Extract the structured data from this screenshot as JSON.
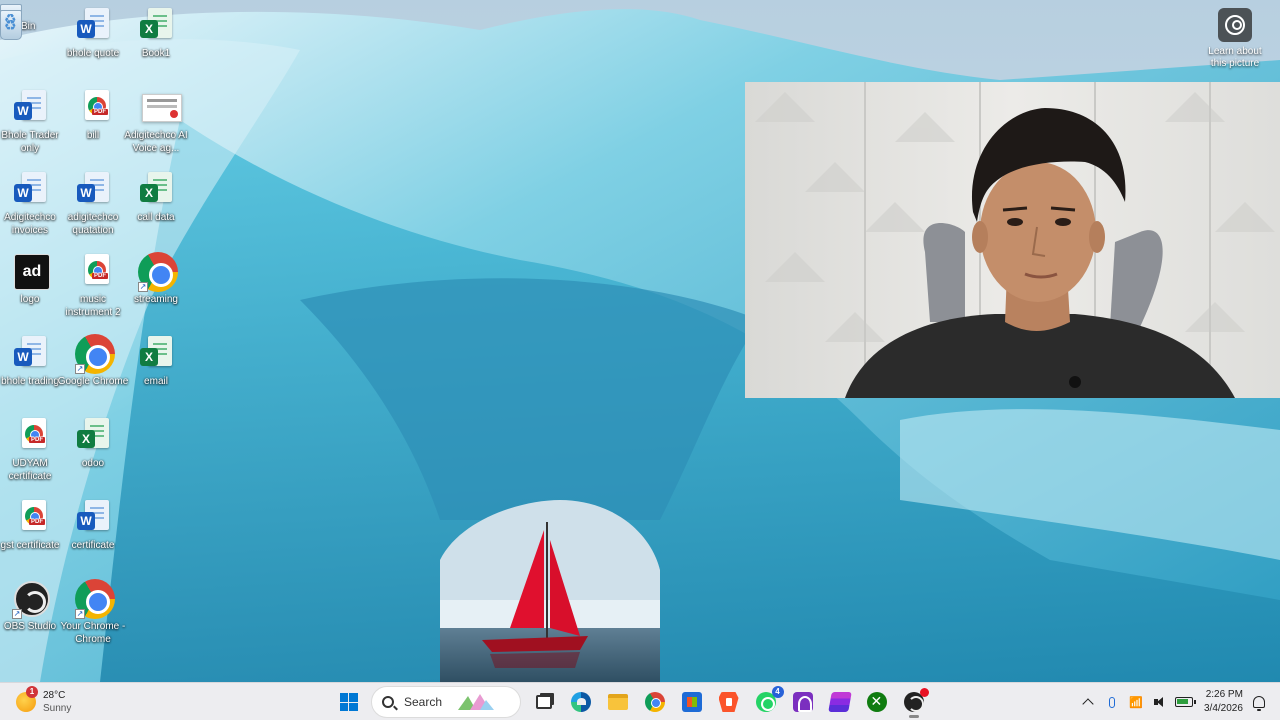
{
  "desktop": {
    "icons": [
      {
        "label": "Recycle Bin",
        "icon": "recycle-bin-icon",
        "type": "recycle"
      },
      {
        "label": "bhole quote",
        "icon": "word-document-icon",
        "type": "word"
      },
      {
        "label": "Book1",
        "icon": "excel-workbook-icon",
        "type": "excel"
      },
      {
        "label": "Bhole Trader only",
        "icon": "word-document-icon",
        "type": "word"
      },
      {
        "label": "bill",
        "icon": "pdf-document-icon",
        "type": "pdf"
      },
      {
        "label": "Adigitechco AI Voice ag...",
        "icon": "image-file-icon",
        "type": "image"
      },
      {
        "label": "Adigitechco invoices",
        "icon": "word-document-icon",
        "type": "word"
      },
      {
        "label": "adigitechco quatation",
        "icon": "word-document-icon",
        "type": "word"
      },
      {
        "label": "call data",
        "icon": "excel-workbook-icon",
        "type": "excel"
      },
      {
        "label": "logo",
        "icon": "logo-image-icon",
        "type": "logo"
      },
      {
        "label": "music instrument 2",
        "icon": "pdf-document-icon",
        "type": "pdf"
      },
      {
        "label": "streaming",
        "icon": "chrome-shortcut-icon",
        "type": "chrome"
      },
      {
        "label": "bhole trading",
        "icon": "word-document-icon",
        "type": "word"
      },
      {
        "label": "Google Chrome",
        "icon": "google-chrome-icon",
        "type": "chrome"
      },
      {
        "label": "email",
        "icon": "excel-workbook-icon",
        "type": "excel"
      },
      {
        "label": "UDYAM certificate",
        "icon": "pdf-document-icon",
        "type": "pdf"
      },
      {
        "label": "odoo",
        "icon": "excel-workbook-icon",
        "type": "excel"
      },
      {
        "label": "gst certificate",
        "icon": "pdf-document-icon",
        "type": "pdf"
      },
      {
        "label": "certificate",
        "icon": "word-document-icon",
        "type": "word"
      },
      {
        "label": "OBS Studio",
        "icon": "obs-studio-icon",
        "type": "obs"
      },
      {
        "label": "Your Chrome - Chrome",
        "icon": "chrome-profile-icon",
        "type": "chrome"
      }
    ],
    "learn_about_picture": "Learn about this picture"
  },
  "taskbar": {
    "weather": {
      "temperature": "28°C",
      "condition": "Sunny",
      "badge": "1",
      "icon": "sun-icon"
    },
    "start_icon": "windows-start-icon",
    "search_placeholder": "Search",
    "apps": [
      {
        "name": "task-view",
        "icon": "task-view-icon"
      },
      {
        "name": "microsoft-edge",
        "icon": "edge-icon"
      },
      {
        "name": "file-explorer",
        "icon": "folder-icon"
      },
      {
        "name": "google-chrome",
        "icon": "chrome-icon"
      },
      {
        "name": "microsoft-store",
        "icon": "store-icon"
      },
      {
        "name": "brave",
        "icon": "brave-icon"
      },
      {
        "name": "whatsapp",
        "icon": "whatsapp-icon",
        "badge": "4"
      },
      {
        "name": "app-purple",
        "icon": "purple-app-icon"
      },
      {
        "name": "app-stack",
        "icon": "stack-app-icon"
      },
      {
        "name": "xbox",
        "icon": "xbox-icon"
      },
      {
        "name": "obs-studio",
        "icon": "obs-recording-icon"
      }
    ],
    "clock": {
      "time": "2:26 PM",
      "date": "3/4/2026"
    }
  },
  "colors": {
    "accent": "#0078d4",
    "taskbar": "#ededf0"
  }
}
